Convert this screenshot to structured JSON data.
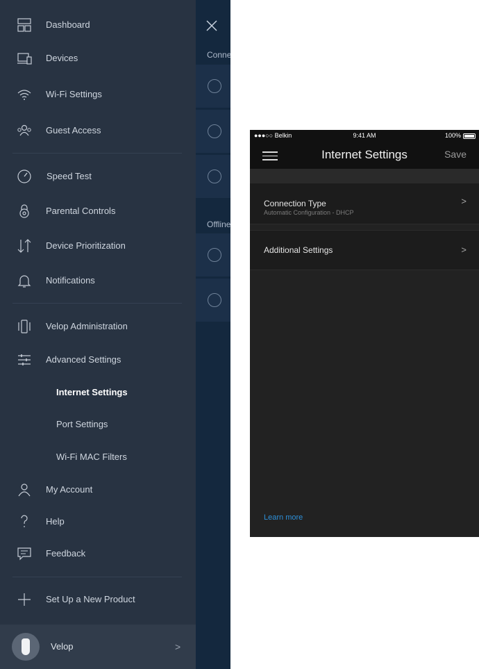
{
  "menu": {
    "items": [
      {
        "label": "Dashboard",
        "icon": "dashboard-icon"
      },
      {
        "label": "Devices",
        "icon": "devices-icon"
      },
      {
        "label": "Wi-Fi Settings",
        "icon": "wifi-icon"
      },
      {
        "label": "Guest Access",
        "icon": "guest-access-icon"
      },
      {
        "label": "Speed Test",
        "icon": "speed-test-icon"
      },
      {
        "label": "Parental Controls",
        "icon": "parental-controls-icon"
      },
      {
        "label": "Device Prioritization",
        "icon": "prioritization-icon"
      },
      {
        "label": "Notifications",
        "icon": "bell-icon"
      },
      {
        "label": "Velop Administration",
        "icon": "velop-admin-icon"
      },
      {
        "label": "Advanced Settings",
        "icon": "sliders-icon"
      }
    ],
    "sub_items": [
      {
        "label": "Internet Settings",
        "active": true
      },
      {
        "label": "Port Settings",
        "active": false
      },
      {
        "label": "Wi-Fi MAC Filters",
        "active": false
      }
    ],
    "bottom_items": [
      {
        "label": "My Account",
        "icon": "user-icon"
      },
      {
        "label": "Help",
        "icon": "question-icon"
      },
      {
        "label": "Feedback",
        "icon": "feedback-icon"
      },
      {
        "label": "Set Up a New Product",
        "icon": "plus-icon"
      }
    ],
    "velop": {
      "label": "Velop",
      "chevron": ">"
    }
  },
  "behind": {
    "connected_label": "Conne",
    "offline_label": "Offline"
  },
  "phone": {
    "status": {
      "carrier": "●●●○○ Belkin",
      "time": "9:41 AM",
      "battery": "100%"
    },
    "title": "Internet Settings",
    "save_label": "Save",
    "rows": [
      {
        "title": "Connection Type",
        "subtitle": "Automatic Configuration - DHCP",
        "chevron": ">"
      },
      {
        "title": "Additional Settings",
        "chevron": ">"
      }
    ],
    "learn_more": "Learn more"
  },
  "colors": {
    "drawer": "#283342",
    "phone_bg": "#222222",
    "link": "#2d8fd8"
  }
}
